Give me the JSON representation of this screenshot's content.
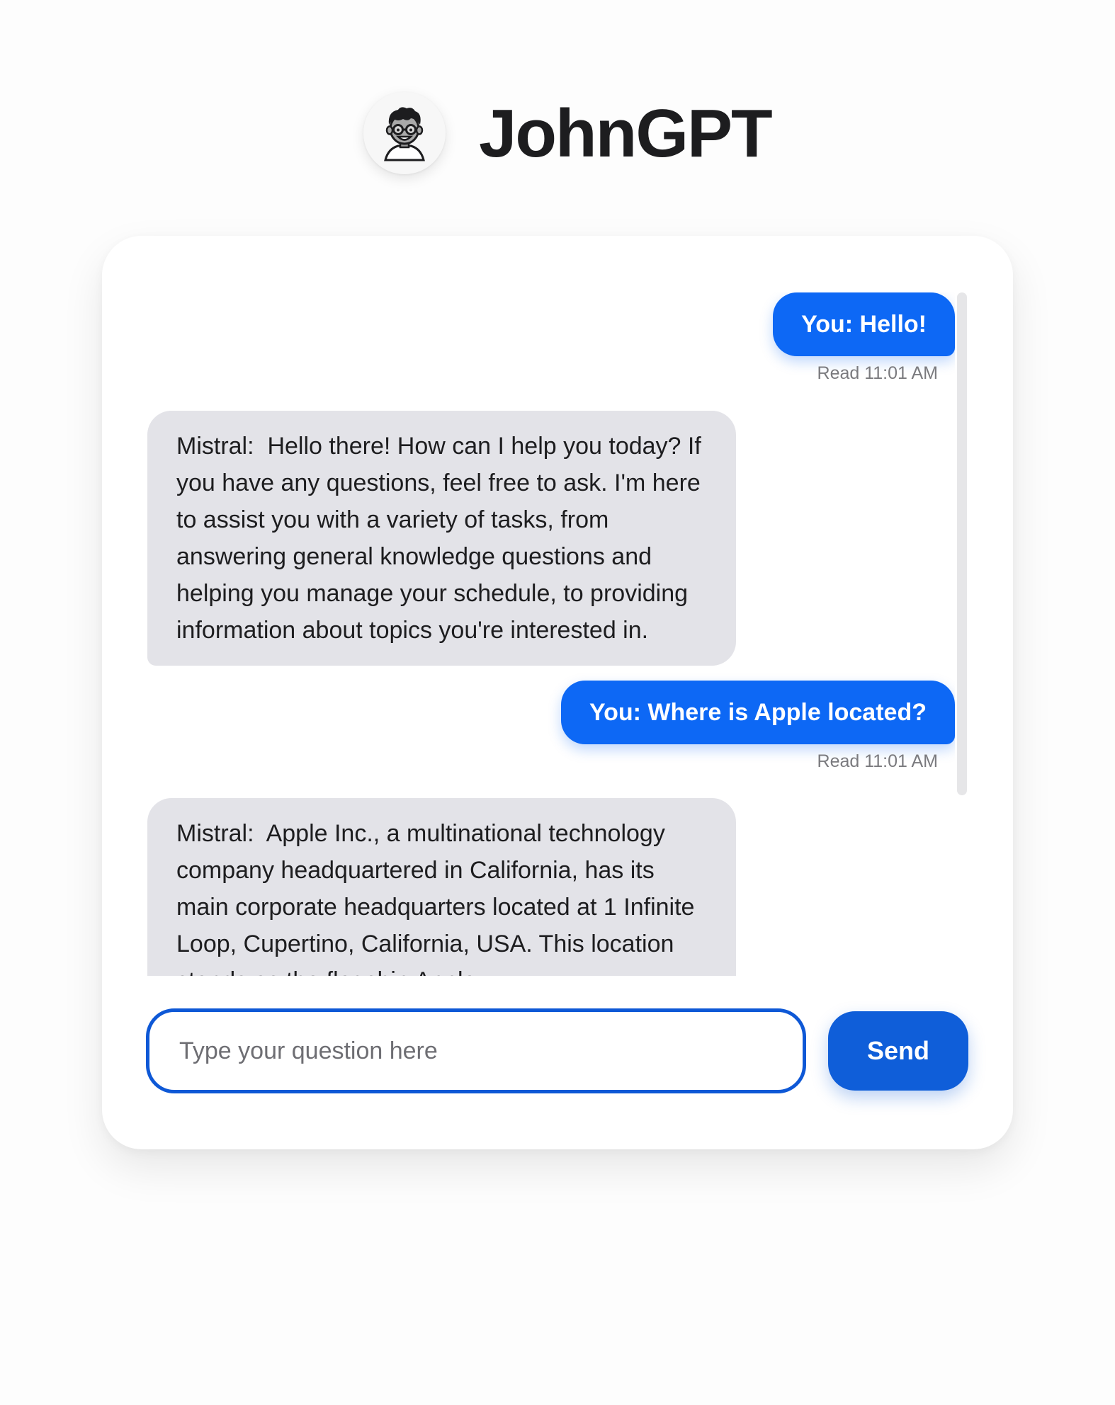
{
  "header": {
    "title": "JohnGPT",
    "avatar_icon": "cartoon-face-with-glasses-icon"
  },
  "messages": [
    {
      "role": "user",
      "sender": "You",
      "text": "You: Hello!",
      "receipt": "Read 11:01 AM"
    },
    {
      "role": "assistant",
      "sender": "Mistral",
      "label": "Mistral:  ",
      "text": "Hello there! How can I help you today? If you have any questions, feel free to ask. I'm here to assist you with a variety of tasks, from answering general knowledge questions and helping you manage your schedule, to providing information about topics you're interested in."
    },
    {
      "role": "user",
      "sender": "You",
      "text": "You: Where is Apple located?",
      "receipt": "Read 11:01 AM"
    },
    {
      "role": "assistant",
      "sender": "Mistral",
      "label": "Mistral:  ",
      "text": "Apple Inc., a multinational technology company headquartered in California, has its main corporate headquarters located at 1 Infinite Loop, Cupertino, California, USA. This location stands as the flagship Apple"
    }
  ],
  "composer": {
    "placeholder": "Type your question here",
    "value": "",
    "send_label": "Send"
  },
  "colors": {
    "user_bubble": "#0d68f5",
    "assistant_bubble": "#e3e3e8",
    "accent": "#0f5ed9",
    "input_border": "#0e58d6",
    "page_background": "#fdfdfd"
  }
}
